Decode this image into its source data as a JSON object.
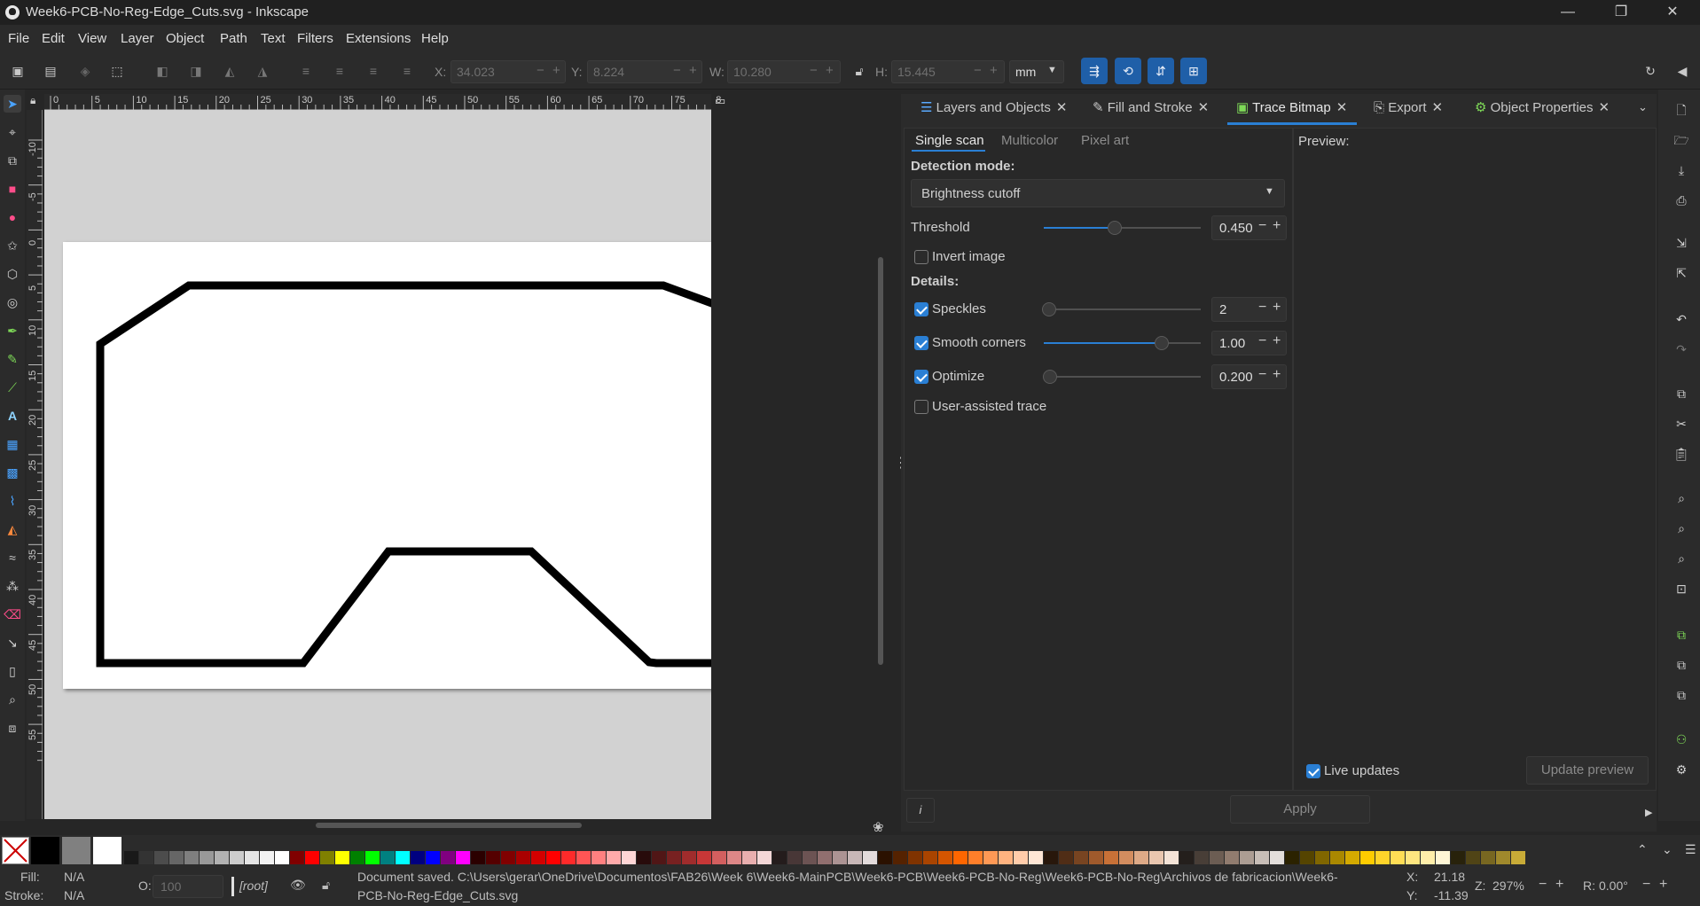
{
  "window": {
    "title": "Week6-PCB-No-Reg-Edge_Cuts.svg - Inkscape",
    "minimize": "—",
    "maximize": "❐",
    "close": "✕"
  },
  "menu": [
    "File",
    "Edit",
    "View",
    "Layer",
    "Object",
    "Path",
    "Text",
    "Filters",
    "Extensions",
    "Help"
  ],
  "toolbar": {
    "x_label": "X:",
    "x_value": "34.023",
    "y_label": "Y:",
    "y_value": "8.224",
    "w_label": "W:",
    "w_value": "10.280",
    "h_label": "H:",
    "h_value": "15.445",
    "unit": "mm",
    "minus": "−",
    "plus": "+"
  },
  "rulers": {
    "horizontal": [
      "0",
      "5",
      "10",
      "15",
      "20",
      "25",
      "30",
      "35",
      "40",
      "45",
      "50",
      "55",
      "60",
      "65",
      "70",
      "75",
      "8"
    ],
    "vertical": [
      "-10",
      "-5",
      "0",
      "5",
      "10",
      "15",
      "20",
      "25",
      "30",
      "35",
      "40",
      "45",
      "50",
      "55"
    ]
  },
  "dock": {
    "tabs": [
      {
        "label": "Layers and Objects",
        "active": false
      },
      {
        "label": "Fill and Stroke",
        "active": false
      },
      {
        "label": "Trace Bitmap",
        "active": true
      },
      {
        "label": "Export",
        "active": false
      },
      {
        "label": "Object Properties",
        "active": false
      }
    ],
    "close_glyph": "✕",
    "subtabs": [
      {
        "label": "Single scan",
        "active": true
      },
      {
        "label": "Multicolor",
        "active": false
      },
      {
        "label": "Pixel art",
        "active": false
      }
    ],
    "detection_mode_label": "Detection mode:",
    "detection_mode_value": "Brightness cutoff",
    "threshold": {
      "label": "Threshold",
      "value": "0.450",
      "level": 0.45
    },
    "invert_image": {
      "label": "Invert image",
      "checked": false
    },
    "details_label": "Details:",
    "speckles": {
      "label": "Speckles",
      "checked": true,
      "value": "2",
      "level": 0.0
    },
    "smooth_corners": {
      "label": "Smooth corners",
      "checked": true,
      "value": "1.00",
      "level": 0.75
    },
    "optimize": {
      "label": "Optimize",
      "checked": true,
      "value": "0.200",
      "level": 0.04
    },
    "user_assisted": {
      "label": "User-assisted trace",
      "checked": false
    },
    "preview_label": "Preview:",
    "live_updates": {
      "label": "Live updates",
      "checked": true
    },
    "update_preview_button": "Update preview",
    "apply_button": "Apply",
    "info_glyph": "i"
  },
  "palette": {
    "colors": [
      "#000000",
      "#808080",
      "#ffffff",
      "#191919",
      "#333333",
      "#4c4c4c",
      "#666666",
      "#7f7f7f",
      "#999999",
      "#b2b2b2",
      "#cccccc",
      "#e5e5e5",
      "#f2f2f2",
      "#ffffff",
      "#800000",
      "#ff0000",
      "#808000",
      "#ffff00",
      "#008000",
      "#00ff00",
      "#008080",
      "#00ffff",
      "#000080",
      "#0000ff",
      "#800080",
      "#ff00ff",
      "#2b0000",
      "#550000",
      "#800000",
      "#aa0000",
      "#d40000",
      "#ff0000",
      "#ff2a2a",
      "#ff5555",
      "#ff8080",
      "#ffaaaa",
      "#ffd5d5",
      "#280b0b",
      "#501616",
      "#782121",
      "#a02c2c",
      "#c83737",
      "#d35f5f",
      "#de8787",
      "#e9afaf",
      "#f4d7d7",
      "#241c1c",
      "#483737",
      "#6c5353",
      "#916f6f",
      "#ac9393",
      "#c8b7b7",
      "#e3dbdb",
      "#2b1100",
      "#552200",
      "#803300",
      "#aa4400",
      "#d45500",
      "#ff6600",
      "#ff7f2a",
      "#ff9955",
      "#ffb380",
      "#ffccaa",
      "#ffe6d5",
      "#28170b",
      "#502d16",
      "#784421",
      "#a05a2c",
      "#c87137",
      "#d38d5f",
      "#deaa87",
      "#e9c6af",
      "#f4e3d7",
      "#241f1c",
      "#483e37",
      "#6c5d53",
      "#917c6f",
      "#ac9d93",
      "#c8beb7",
      "#e3dedb",
      "#2b2200",
      "#554400",
      "#806600",
      "#aa8800",
      "#d4aa00",
      "#ffcc00",
      "#ffd42a",
      "#ffdd55",
      "#ffe680",
      "#ffeeaa",
      "#fff6d5",
      "#28220b",
      "#504416",
      "#786721",
      "#a0892c",
      "#c8ab37"
    ]
  },
  "status": {
    "fill_label": "Fill:",
    "fill_value": "N/A",
    "stroke_label": "Stroke:",
    "stroke_value": "N/A",
    "opacity_label": "O:",
    "opacity_value": "100",
    "layer": "[root]",
    "message_line1": "Document saved. C:\\Users\\gerar\\OneDrive\\Documentos\\FAB26\\Week 6\\Week6-MainPCB\\Week6-PCB\\Week6-PCB-No-Reg\\Week6-PCB-No-Reg\\Archivos de fabricacion\\Week6-",
    "message_line2": "PCB-No-Reg-Edge_Cuts.svg",
    "cursor_x_label": "X:",
    "cursor_x": "21.18",
    "cursor_y_label": "Y:",
    "cursor_y": "-11.39",
    "zoom_label": "Z:",
    "zoom": "297%",
    "rotation_label": "R:",
    "rotation": "0.00°"
  }
}
